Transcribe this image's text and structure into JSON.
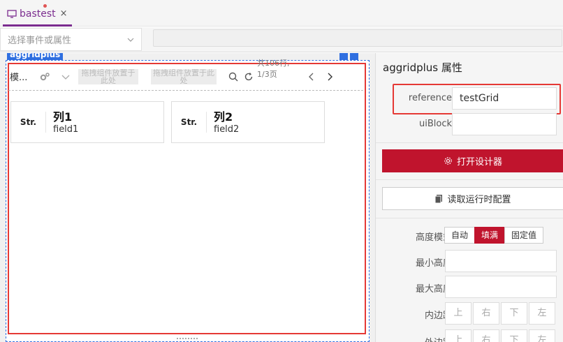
{
  "tab": {
    "label": "bastest",
    "close": "×"
  },
  "event_bar": {
    "select_placeholder": "选择事件或属性",
    "input_value": ""
  },
  "component": {
    "badge": "aggridplus"
  },
  "grid_toolbar": {
    "title": "模...",
    "slot1": "拖拽组件放置于此处",
    "slot2": "拖拽组件放置于此处",
    "row_info": "共106行, 1/3页"
  },
  "columns": [
    {
      "type": "Str.",
      "name": "列1",
      "field": "field1"
    },
    {
      "type": "Str.",
      "name": "列2",
      "field": "field2"
    }
  ],
  "panel": {
    "title": "aggridplus 属性",
    "reference_label": "reference",
    "reference_value": "testGrid",
    "uiblock_label": "uiBlock",
    "uiblock_value": "",
    "designer_button": "打开设计器",
    "config_button": "读取运行时配置",
    "height_mode_label": "高度模式",
    "height_modes": [
      "自动",
      "填满",
      "固定值"
    ],
    "height_mode_selected": "填满",
    "min_height_label": "最小高度",
    "max_height_label": "最大高度",
    "padding_label": "内边距",
    "margin_label": "外边距",
    "directions": [
      "上",
      "右",
      "下",
      "左"
    ]
  },
  "colors": {
    "accent": "#c0142d",
    "selection": "#2f6fe0",
    "highlight": "#e53935",
    "tab": "#7b2d8f"
  }
}
